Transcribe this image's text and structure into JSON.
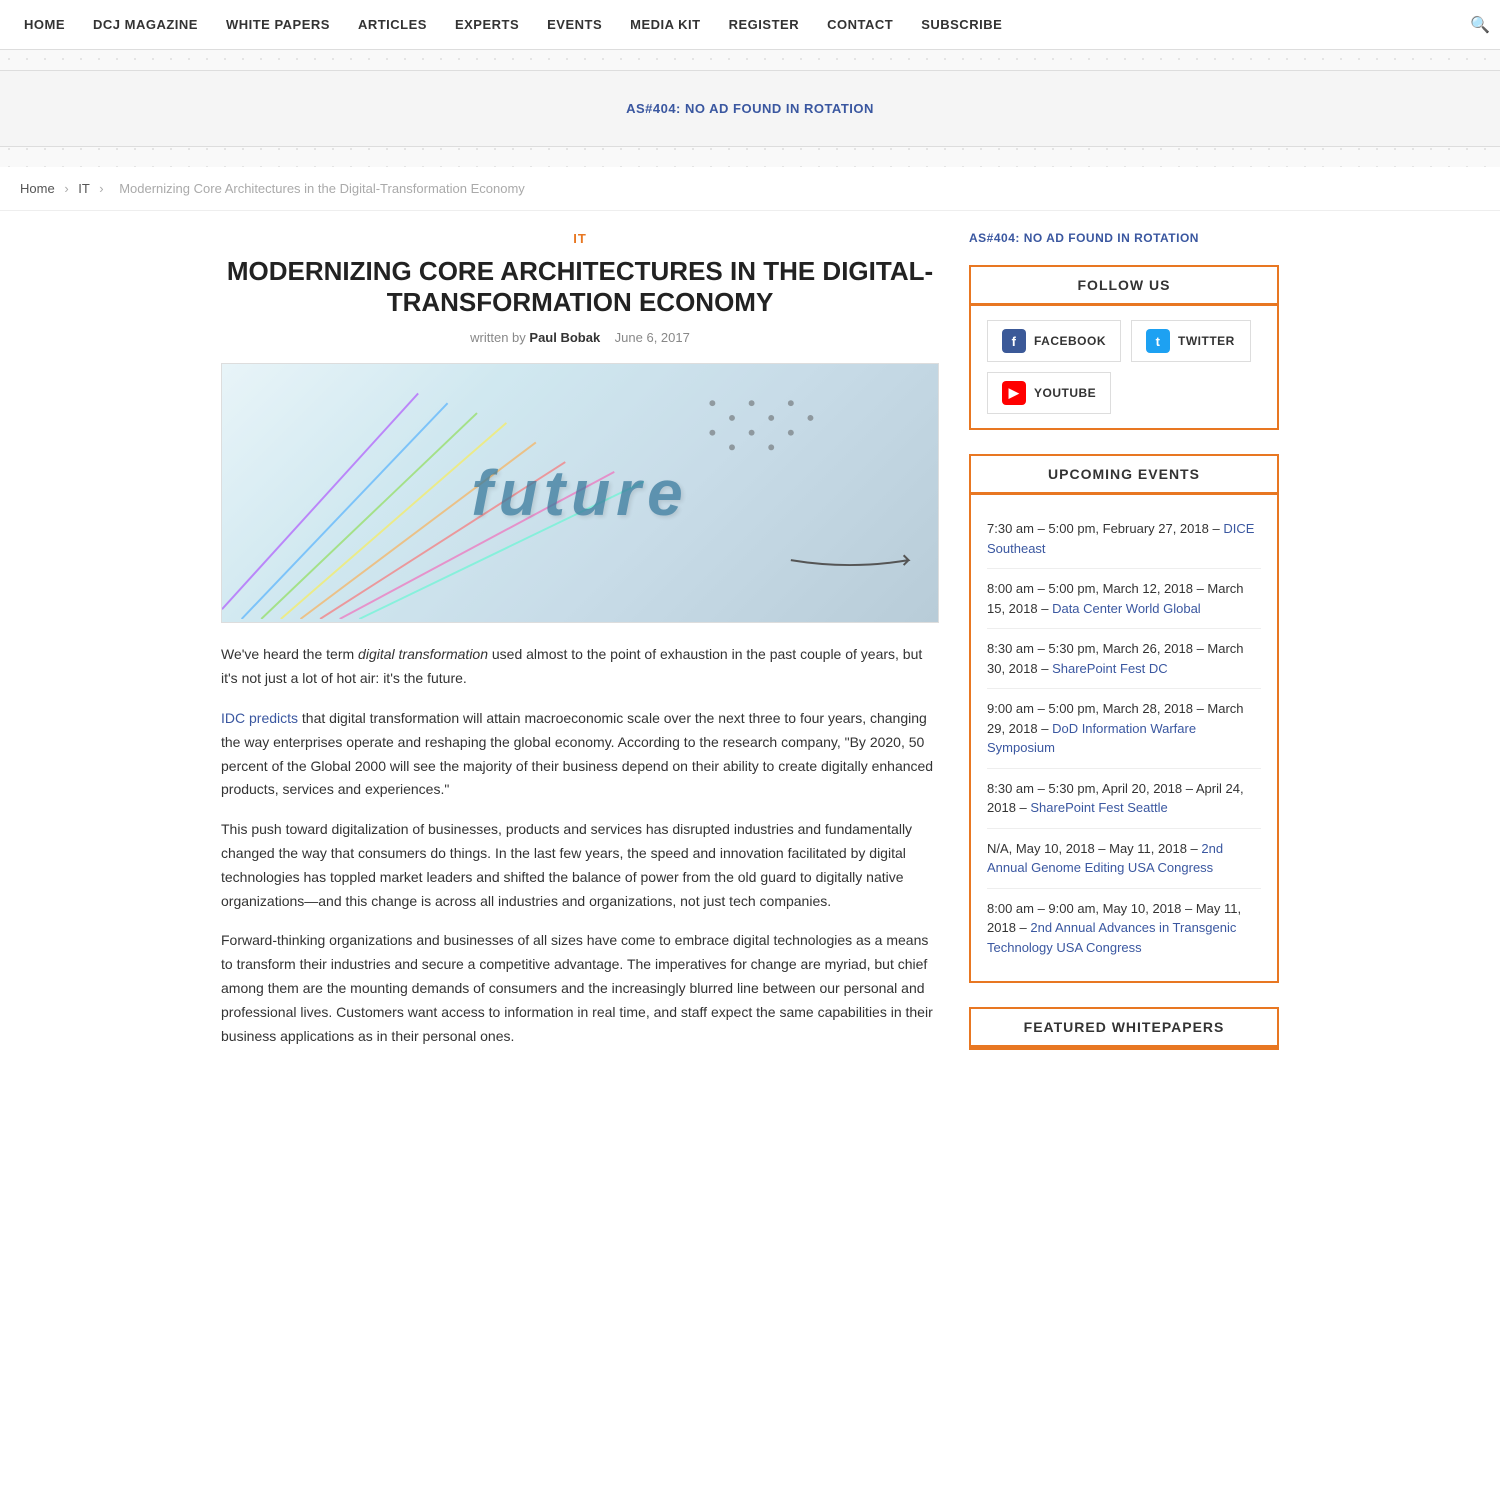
{
  "nav": {
    "items": [
      {
        "label": "HOME",
        "href": "#"
      },
      {
        "label": "DCJ MAGAZINE",
        "href": "#"
      },
      {
        "label": "WHITE PAPERS",
        "href": "#"
      },
      {
        "label": "ARTICLES",
        "href": "#"
      },
      {
        "label": "EXPERTS",
        "href": "#"
      },
      {
        "label": "EVENTS",
        "href": "#"
      },
      {
        "label": "MEDIA KIT",
        "href": "#"
      },
      {
        "label": "REGISTER",
        "href": "#"
      },
      {
        "label": "CONTACT",
        "href": "#"
      },
      {
        "label": "SUBSCRIBE",
        "href": "#"
      }
    ]
  },
  "ad_banner": {
    "text": "AS#404: NO AD FOUND IN ROTATION"
  },
  "breadcrumb": {
    "home": "Home",
    "it": "IT",
    "current": "Modernizing Core Architectures in the Digital-Transformation Economy"
  },
  "article": {
    "category": "IT",
    "title_line1": "MODERNIZING CORE ARCHITECTURES IN THE DIGITAL-",
    "title_line2": "TRANSFORMATION ECONOMY",
    "written_by": "written by",
    "author": "Paul Bobak",
    "date": "June 6, 2017",
    "image_alt": "future",
    "image_word": "future",
    "paragraphs": [
      {
        "html": "We've heard the term <em>digital transformation</em> used almost to the point of exhaustion in the past couple of years, but it's not just a lot of hot air: it's the future."
      },
      {
        "html": "<a href=\"#\">IDC predicts</a> that digital transformation will attain macroeconomic scale over the next three to four years, changing the way enterprises operate and reshaping the global economy. According to the research company, \"By 2020, 50 percent of the Global 2000 will see the majority of their business depend on their ability to create digitally enhanced products, services and experiences.\""
      },
      {
        "html": "This push toward digitalization of businesses, products and services has disrupted industries and fundamentally changed the way that consumers do things. In the last few years, the speed and innovation facilitated by digital technologies has toppled market leaders and shifted the balance of power from the old guard to digitally native organizations—and this change is across all industries and organizations, not just tech companies."
      },
      {
        "html": "Forward-thinking organizations and businesses of all sizes have come to embrace digital technologies as a means to transform their industries and secure a competitive advantage. The imperatives for change are myriad, but chief among them are the mounting demands of consumers and the increasingly blurred line between our personal and professional lives. Customers want access to information in real time, and staff expect the same capabilities in their business applications as in their personal ones."
      }
    ]
  },
  "sidebar": {
    "ad_text": "AS#404: NO AD FOUND IN ROTATION",
    "follow_us": {
      "title": "FOLLOW US",
      "buttons": [
        {
          "label": "FACEBOOK",
          "icon": "fb",
          "href": "#"
        },
        {
          "label": "TWITTER",
          "icon": "tw",
          "href": "#"
        },
        {
          "label": "YOUTUBE",
          "icon": "yt",
          "href": "#"
        }
      ]
    },
    "upcoming_events": {
      "title": "UPCOMING EVENTS",
      "events": [
        {
          "time": "7:30 am – 5:00 pm, February 27, 2018 –",
          "link_text": "DICE Southeast",
          "link_href": "#"
        },
        {
          "time": "8:00 am – 5:00 pm, March 12, 2018 – March 15, 2018 –",
          "link_text": "Data Center World Global",
          "link_href": "#"
        },
        {
          "time": "8:30 am – 5:30 pm, March 26, 2018 – March 30, 2018 –",
          "link_text": "SharePoint Fest DC",
          "link_href": "#"
        },
        {
          "time": "9:00 am – 5:00 pm, March 28, 2018 – March 29, 2018 –",
          "link_text": "DoD Information Warfare Symposium",
          "link_href": "#"
        },
        {
          "time": "8:30 am – 5:30 pm, April 20, 2018 – April 24, 2018 –",
          "link_text": "SharePoint Fest Seattle",
          "link_href": "#"
        },
        {
          "time": "N/A, May 10, 2018 – May 11, 2018 –",
          "link_text": "2nd Annual Genome Editing USA Congress",
          "link_href": "#"
        },
        {
          "time": "8:00 am – 9:00 am, May 10, 2018 – May 11, 2018 –",
          "link_text": "2nd Annual Advances in Transgenic Technology USA Congress",
          "link_href": "#"
        }
      ]
    },
    "featured_whitepapers": {
      "title": "FEATURED WHITEPAPERS"
    }
  }
}
